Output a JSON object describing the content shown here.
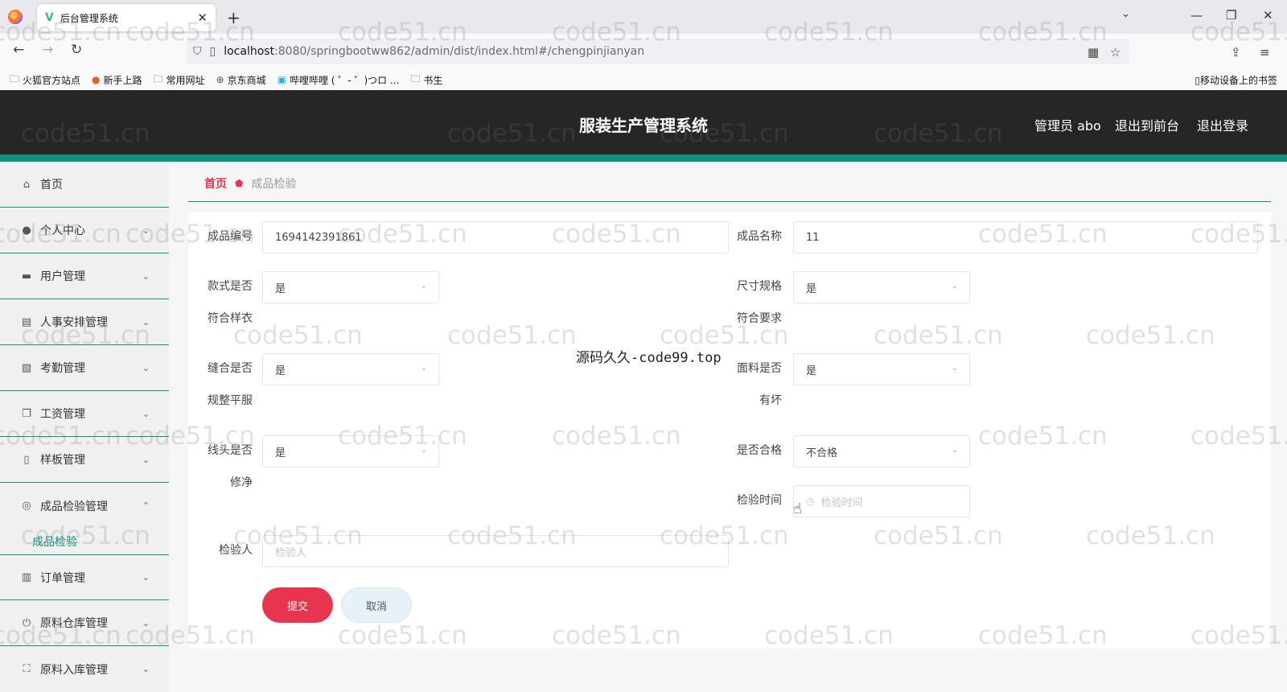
{
  "browser": {
    "tab_title": "后台管理系统",
    "url_host": "localhost",
    "url_rest": ":8080/springbootww862/admin/dist/index.html#/chengpinjianyan",
    "bookmarks": [
      "火狐官方站点",
      "新手上路",
      "常用网址",
      "京东商城",
      "哔哩哔哩 ( ゜- ゜)つロ ...",
      "书生"
    ],
    "mobile_bookmarks": "移动设备上的书签"
  },
  "header": {
    "title": "服装生产管理系统",
    "user": "管理员 abo",
    "to_front": "退出到前台",
    "logout": "退出登录"
  },
  "sidebar": {
    "items": [
      {
        "label": "首页",
        "icon": "home-icon"
      },
      {
        "label": "个人中心",
        "icon": "user-icon"
      },
      {
        "label": "用户管理",
        "icon": "briefcase-icon"
      },
      {
        "label": "人事安排管理",
        "icon": "clipboard-icon"
      },
      {
        "label": "考勤管理",
        "icon": "chart-icon"
      },
      {
        "label": "工资管理",
        "icon": "copy-icon"
      },
      {
        "label": "样板管理",
        "icon": "mobile-icon"
      },
      {
        "label": "成品检验管理",
        "icon": "compass-icon"
      },
      {
        "label": "订单管理",
        "icon": "bars-icon"
      },
      {
        "label": "原料仓库管理",
        "icon": "power-icon"
      },
      {
        "label": "原料入库管理",
        "icon": "expand-icon"
      }
    ],
    "sub_active": "成品检验"
  },
  "breadcrumb": {
    "home": "首页",
    "current": "成品检验"
  },
  "form": {
    "product_no": {
      "label": "成品编号",
      "value": "1694142391861"
    },
    "product_name": {
      "label": "成品名称",
      "value": "11"
    },
    "style_match": {
      "label_line1": "款式是否",
      "label_line2": "符合样衣",
      "value": "是"
    },
    "size_spec": {
      "label_line1": "尺寸规格",
      "label_line2": "符合要求",
      "value": "是"
    },
    "seam_flat": {
      "label_line1": "缝合是否",
      "label_line2": "规整平服",
      "value": "是"
    },
    "fabric_damage": {
      "label_line1": "面料是否",
      "label_line2": "有坏",
      "value": "是"
    },
    "thread_clean": {
      "label_line1": "线头是否",
      "label_line2": "修净",
      "value": "是"
    },
    "qualified": {
      "label": "是否合格",
      "value": "不合格"
    },
    "inspect_time": {
      "label": "检验时间",
      "placeholder": "检验时间"
    },
    "inspector": {
      "label": "检验人",
      "placeholder": "检验人"
    },
    "submit": "提交",
    "cancel": "取消"
  },
  "watermarks": {
    "site": "code51.cn",
    "center": "源码久久-code99.top"
  }
}
